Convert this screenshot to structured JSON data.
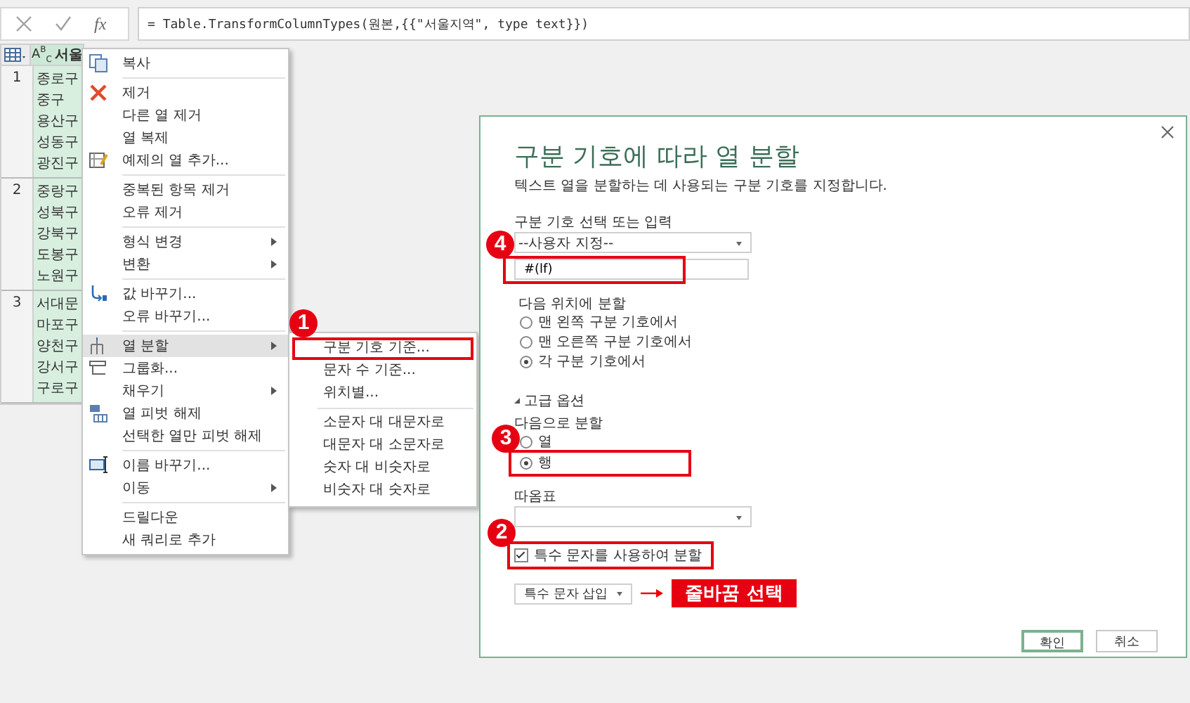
{
  "formula_bar": {
    "function_label": "fx",
    "formula": "= Table.TransformColumnTypes(원본,{{\"서울지역\", type text}})"
  },
  "table": {
    "type_label": "A$^{B}$$_{C}$",
    "column": "서울",
    "rows": [
      {
        "number": "1",
        "values": [
          "종로구",
          "중구",
          "용산구",
          "성동구",
          "광진구"
        ]
      },
      {
        "number": "2",
        "values": [
          "중랑구",
          "성북구",
          "강북구",
          "도봉구",
          "노원구"
        ]
      },
      {
        "number": "3",
        "values": [
          "서대문",
          "마포구",
          "양천구",
          "강서구",
          "구로구"
        ]
      }
    ]
  },
  "context_menu": {
    "groups": [
      [
        {
          "label": "복사",
          "submenu": false,
          "selected": false
        }
      ],
      [
        {
          "label": "제거",
          "submenu": false,
          "selected": false
        },
        {
          "label": "다른 열 제거",
          "submenu": false,
          "selected": false
        },
        {
          "label": "열 복제",
          "submenu": false,
          "selected": false
        },
        {
          "label": "예제의 열 추가...",
          "submenu": false,
          "selected": false
        }
      ],
      [
        {
          "label": "중복된 항목 제거",
          "submenu": false,
          "selected": false
        },
        {
          "label": "오류 제거",
          "submenu": false,
          "selected": false
        }
      ],
      [
        {
          "label": "형식 변경",
          "submenu": true,
          "selected": false
        },
        {
          "label": "변환",
          "submenu": true,
          "selected": false
        }
      ],
      [
        {
          "label": "값 바꾸기...",
          "submenu": false,
          "selected": false
        },
        {
          "label": "오류 바꾸기...",
          "submenu": false,
          "selected": false
        }
      ],
      [
        {
          "label": "열 분할",
          "submenu": true,
          "selected": true
        },
        {
          "label": "그룹화...",
          "submenu": false,
          "selected": false
        },
        {
          "label": "채우기",
          "submenu": true,
          "selected": false
        },
        {
          "label": "열 피벗 해제",
          "submenu": false,
          "selected": false
        },
        {
          "label": "선택한 열만 피벗 해제",
          "submenu": false,
          "selected": false
        }
      ],
      [
        {
          "label": "이름 바꾸기...",
          "submenu": false,
          "selected": false
        },
        {
          "label": "이동",
          "submenu": true,
          "selected": false
        }
      ],
      [
        {
          "label": "드릴다운",
          "submenu": false,
          "selected": false
        },
        {
          "label": "새 쿼리로 추가",
          "submenu": false,
          "selected": false
        }
      ]
    ]
  },
  "submenu": {
    "groups": [
      [
        {
          "label": "구분 기호 기준...",
          "callout": "1"
        },
        {
          "label": "문자 수 기준..."
        },
        {
          "label": "위치별..."
        }
      ],
      [
        {
          "label": "소문자 대 대문자로"
        },
        {
          "label": "대문자 대 소문자로"
        },
        {
          "label": "숫자 대 비숫자로"
        },
        {
          "label": "비숫자 대 숫자로"
        }
      ]
    ]
  },
  "dialog": {
    "title": "구분 기호에 따라 열 분할",
    "description": "텍스트 열을 분할하는 데 사용되는 구분 기호를 지정합니다.",
    "delimiter_label": "구분 기호 선택 또는 입력",
    "delimiter_select": "--사용자 지정--",
    "delimiter_value": "#(lf)",
    "delimiter_callout": "4",
    "split_at_label": "다음 위치에 분할",
    "split_at": [
      {
        "label": "맨 왼쪽 구분 기호에서",
        "selected": false
      },
      {
        "label": "맨 오른쪽 구분 기호에서",
        "selected": false
      },
      {
        "label": "각 구분 기호에서",
        "selected": true
      }
    ],
    "advanced": {
      "label": "고급 옵션",
      "expanded": true,
      "split_into_label": "다음으로 분할",
      "split_into": [
        {
          "label": "열",
          "selected": false
        },
        {
          "label": "행",
          "selected": true,
          "callout": "3"
        }
      ],
      "quote_label": "따옴표",
      "special_checkbox": {
        "label": "특수 문자를 사용하여 분할",
        "checked": true,
        "callout": "2"
      },
      "insert_button": "특수 문자 삽입",
      "note": "줄바꿈 선택"
    },
    "buttons": [
      {
        "label": "확인",
        "default": true
      },
      {
        "label": "취소",
        "default": false
      }
    ]
  }
}
